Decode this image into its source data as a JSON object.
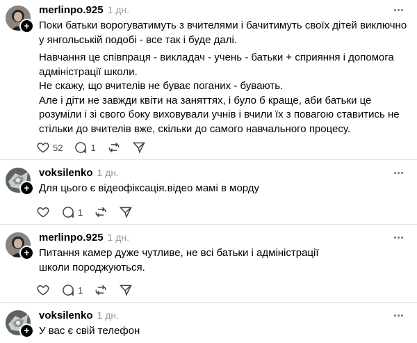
{
  "comments": [
    {
      "username": "merlinpo.925",
      "time": "1 дн.",
      "avatar": "merlinpo-avatar",
      "paragraphs": [
        "Поки батьки ворогуватимуть з вчителями і бачитимуть своїх дітей виключно у янгольській подобі - все так і буде далі.",
        "Навчання це співпраця - викладач - учень - батьки + сприяння і допомога адміністрації школи.\nНе скажу, що вчителів не буває поганих - бувають.\nАле і діти не завжди квіти на заняттях, і було б краще, аби батьки це розуміли і зі свого боку виховували учнів і вчили їх з повагою ставитись не стільки до вчителів вже, скільки до самого навчального процесу."
      ],
      "likes": "52",
      "replies": "1",
      "reposts": "",
      "icons": [
        "heart-icon",
        "comment-icon",
        "repost-icon",
        "share-icon"
      ]
    },
    {
      "username": "voksilenko",
      "time": "1 дн.",
      "avatar": "voksilenko-avatar",
      "paragraphs": [
        "Для цього є відеофіксація.відео мамі в морду"
      ],
      "likes": "",
      "replies": "1",
      "reposts": ""
    },
    {
      "username": "merlinpo.925",
      "time": "1 дн.",
      "avatar": "merlinpo-avatar",
      "paragraphs": [
        "Питання камер дуже чутливе, не всі батьки і адміністрації\nшколи породжуються."
      ],
      "likes": "",
      "replies": "1",
      "reposts": ""
    },
    {
      "username": "voksilenko",
      "time": "1 дн.",
      "avatar": "voksilenko-avatar",
      "paragraphs": [
        "У вас є свій телефон"
      ]
    }
  ]
}
